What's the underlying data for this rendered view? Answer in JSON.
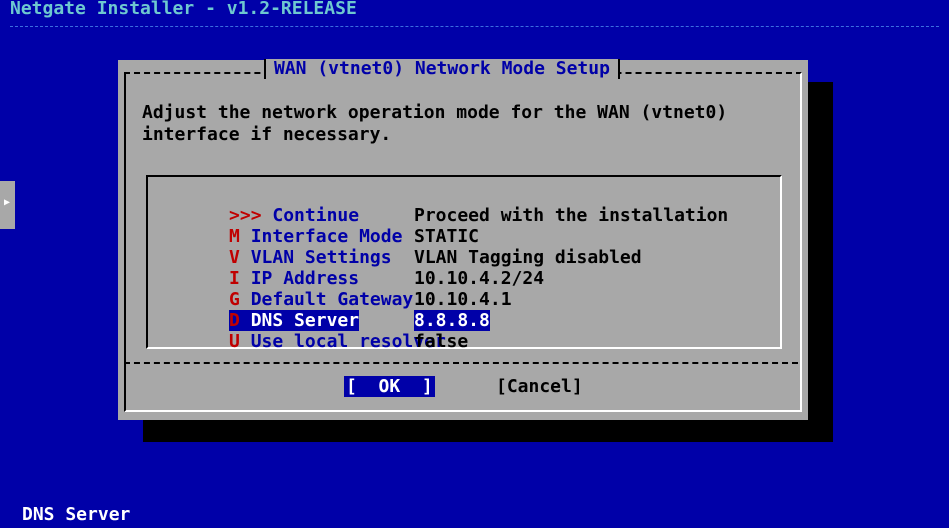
{
  "header": {
    "title": "Netgate Installer - v1.2-RELEASE"
  },
  "status_bar": {
    "text": "DNS Server"
  },
  "dialog": {
    "title": "WAN (vtnet0) Network Mode Setup",
    "message_line1": "Adjust the network operation mode for the WAN (vtnet0)",
    "message_line2": "interface if necessary.",
    "menu": [
      {
        "key": ">>>",
        "label": " Continue",
        "value": "Proceed with the installation"
      },
      {
        "key": "M",
        "label": " Interface Mode",
        "value": "STATIC"
      },
      {
        "key": "V",
        "label": " VLAN Settings",
        "value": "VLAN Tagging disabled"
      },
      {
        "key": "I",
        "label": " IP Address",
        "value": "10.10.4.2/24"
      },
      {
        "key": "G",
        "label": " Default Gateway",
        "value": "10.10.4.1"
      },
      {
        "key": "D",
        "label": " DNS Server",
        "value": "8.8.8.8",
        "selected": true
      },
      {
        "key": "U",
        "label": " Use local resolver",
        "value": "false"
      }
    ],
    "buttons": {
      "ok": "[  OK  ]",
      "cancel": "[Cancel]"
    }
  },
  "colors": {
    "background": "#0000a8",
    "dialog": "#a8a8a8",
    "hotkey": "#c00000",
    "title_text": "#6ec8d0"
  }
}
